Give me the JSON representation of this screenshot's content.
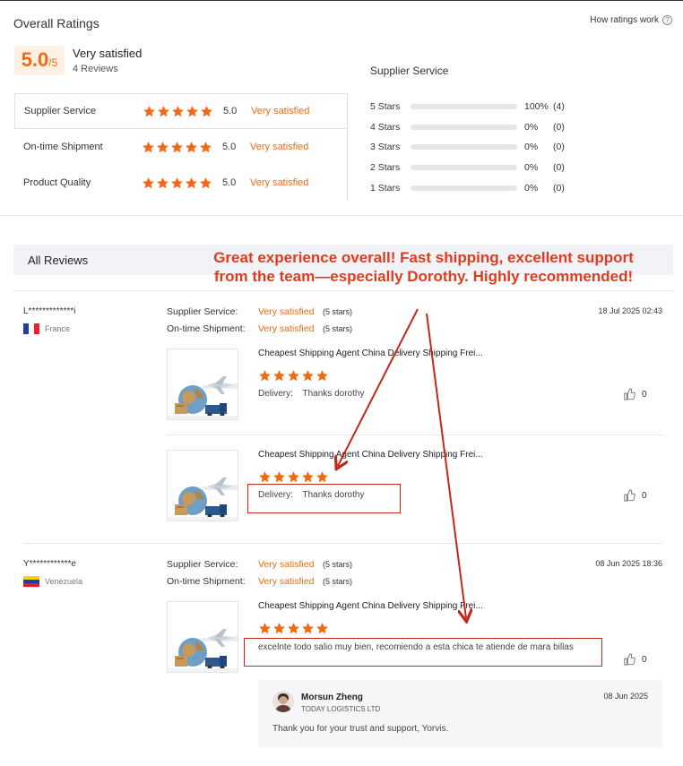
{
  "overall": {
    "title": "Overall Ratings",
    "how_label": "How ratings work",
    "help_glyph": "?",
    "score": "5.0",
    "score_max": "/5",
    "label": "Very satisfied",
    "count": "4 Reviews",
    "categories": [
      {
        "name": "Supplier Service",
        "stars": 5,
        "value": "5.0",
        "word": "Very satisfied"
      },
      {
        "name": "On-time Shipment",
        "stars": 5,
        "value": "5.0",
        "word": "Very satisfied"
      },
      {
        "name": "Product Quality",
        "stars": 5,
        "value": "5.0",
        "word": "Very satisfied"
      }
    ]
  },
  "distribution": {
    "title": "Supplier Service",
    "rows": [
      {
        "label": "5 Stars",
        "fraction": 1.0,
        "pct": "100%",
        "count": "(4)"
      },
      {
        "label": "4 Stars",
        "fraction": 0.0,
        "pct": "0%",
        "count": "(0)"
      },
      {
        "label": "3 Stars",
        "fraction": 0.0,
        "pct": "0%",
        "count": "(0)"
      },
      {
        "label": "2 Stars",
        "fraction": 0.0,
        "pct": "0%",
        "count": "(0)"
      },
      {
        "label": "1 Stars",
        "fraction": 0.0,
        "pct": "0%",
        "count": "(0)"
      }
    ]
  },
  "all_reviews": {
    "title": "All Reviews"
  },
  "reviews": [
    {
      "user": "L*************i",
      "country": "France",
      "date": "18 Jul 2025 02:43",
      "supplier_service_label": "Supplier Service:",
      "supplier_service_value": "Very satisfied",
      "supplier_service_stars": "(5 stars)",
      "shipment_label": "On-time Shipment:",
      "shipment_value": "Very satisfied",
      "shipment_stars": "(5 stars)",
      "items": [
        {
          "title": "Cheapest Shipping Agent China Delivery Shipping Frei...",
          "stars": 5,
          "delivery_label": "Delivery:",
          "delivery_text": "Thanks dorothy",
          "likes": "0"
        },
        {
          "title": "Cheapest Shipping Agent China Delivery Shipping Frei...",
          "stars": 5,
          "delivery_label": "Delivery:",
          "delivery_text": "Thanks dorothy",
          "likes": "0"
        }
      ]
    },
    {
      "user": "Y************e",
      "country": "Venezuela",
      "date": "08 Jun 2025 18:36",
      "supplier_service_label": "Supplier Service:",
      "supplier_service_value": "Very satisfied",
      "supplier_service_stars": "(5 stars)",
      "shipment_label": "On-time Shipment:",
      "shipment_value": "Very satisfied",
      "shipment_stars": "(5 stars)",
      "items": [
        {
          "title": "Cheapest Shipping Agent China Delivery Shipping Frei...",
          "stars": 5,
          "comment": "excelnte todo salio muy bien, recomiendo a esta chica te atiende de mara billas",
          "likes": "0"
        }
      ],
      "reply": {
        "name": "Morsun Zheng",
        "company": "TODAY LOGISTICS LTD",
        "date": "08 Jun 2025",
        "text": "Thank you for your trust and support, Yorvis."
      }
    }
  ],
  "annotation": {
    "text": "Great experience overall! Fast shipping, excellent support from the team—especially Dorothy. Highly recommended!"
  },
  "colors": {
    "accent": "#f26a10",
    "annotation": "#e23a1e",
    "highlight_box": "#c2281c"
  }
}
